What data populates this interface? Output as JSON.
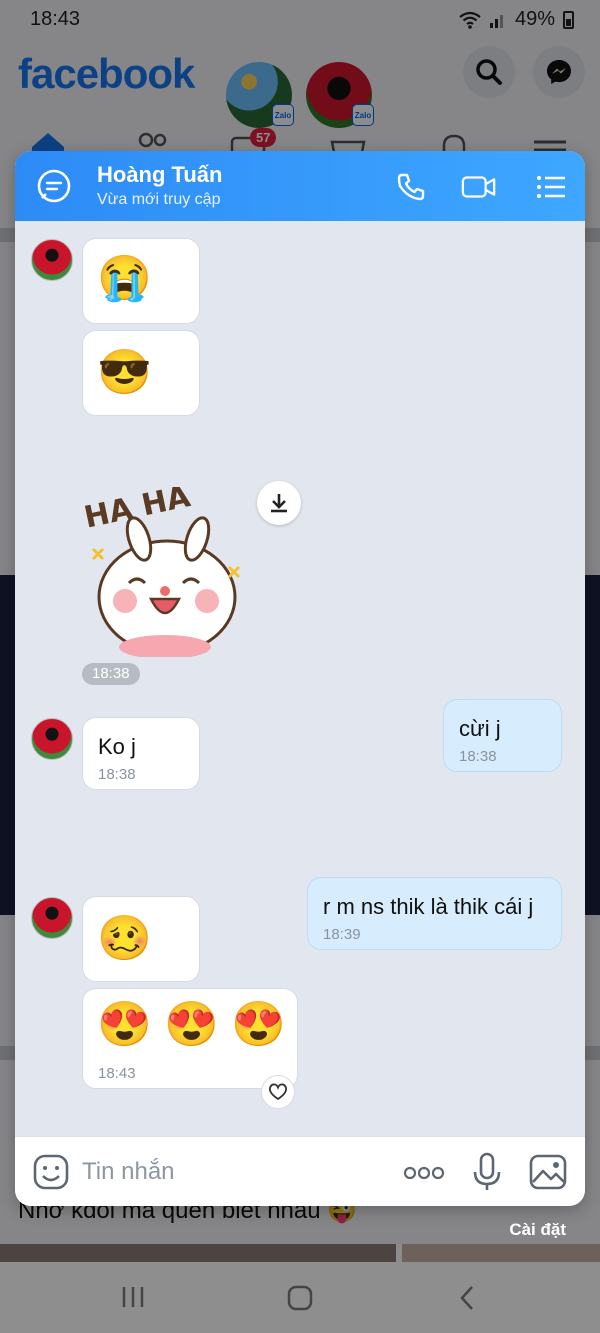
{
  "status_bar": {
    "time": "18:43",
    "battery": "49%"
  },
  "facebook": {
    "logo": "facebook",
    "video_badge": "57",
    "story_badge": "Zalo",
    "post_text": "Nhớ kđổi mà quên biết nhau 😜",
    "settings_label": "Cài đặt"
  },
  "chat": {
    "contact_name": "Hoàng Tuấn",
    "contact_status": "Vừa mới truy cập",
    "messages": [
      {
        "from": "them",
        "emoji": "😭"
      },
      {
        "from": "them",
        "emoji": "😎"
      },
      {
        "from": "them",
        "sticker": "HA HA",
        "time": "18:38"
      },
      {
        "from": "me",
        "text": "cừi j",
        "time": "18:38"
      },
      {
        "from": "them",
        "text": "Ko j",
        "time": "18:38"
      },
      {
        "from": "me",
        "text": "r m ns thik là thik cái j",
        "time": "18:39"
      },
      {
        "from": "them",
        "emoji": "🥴"
      },
      {
        "from": "them",
        "emoji": "😍 😍 😍",
        "time": "18:43"
      }
    ],
    "composer_placeholder": "Tin nhắn"
  },
  "icons": {
    "header": [
      "chat-bubble-icon",
      "phone-icon",
      "video-icon",
      "list-icon"
    ],
    "composer": [
      "sticker-icon",
      "more-icon",
      "mic-icon",
      "image-icon"
    ]
  },
  "colors": {
    "header_start": "#2d8bf6",
    "header_end": "#3ea7ff",
    "my_bubble": "#d7ecfc",
    "chat_bg": "#e2e7ef"
  }
}
